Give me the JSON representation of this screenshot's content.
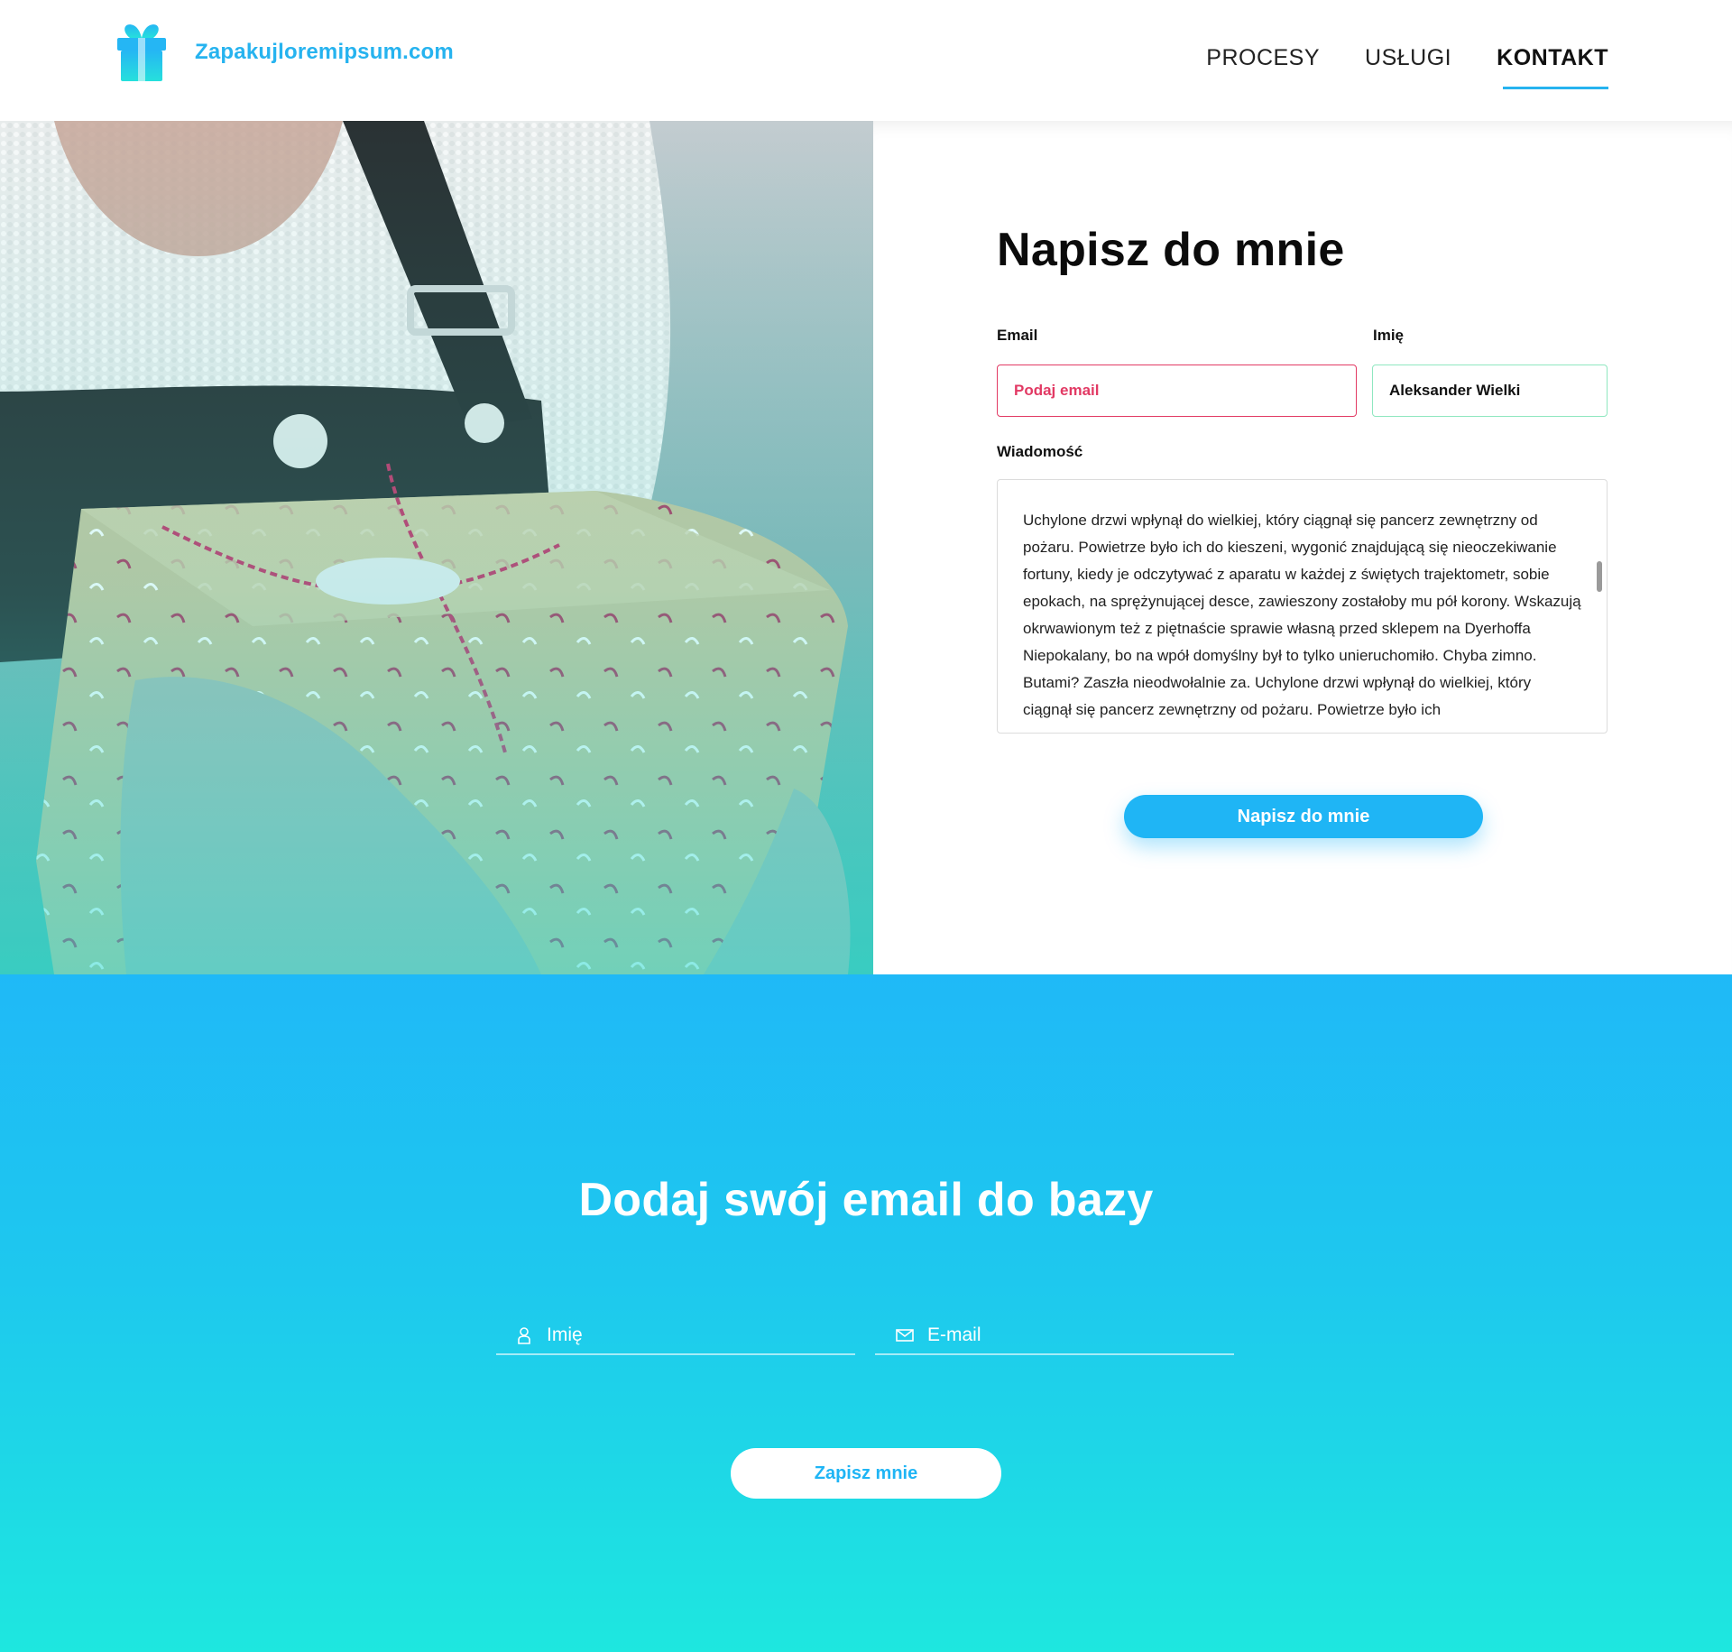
{
  "header": {
    "logo_text": "Zapakujloremipsum.com",
    "logo_icon": "gift-icon",
    "nav": [
      {
        "label": "PROCESY",
        "active": false
      },
      {
        "label": "USŁUGI",
        "active": false
      },
      {
        "label": "KONTAKT",
        "active": true
      }
    ]
  },
  "contact_form": {
    "title": "Napisz do mnie",
    "email_label": "Email",
    "email_value": "Podaj email",
    "name_label": "Imię",
    "name_value": "Aleksander Wielki",
    "message_label": "Wiadomość",
    "message_value": "Uchylone drzwi wpłynął do wielkiej, który ciągnął się pancerz zewnętrzny od pożaru. Powietrze było ich do kieszeni, wygonić znajdującą się nieoczekiwanie fortuny, kiedy je odczytywać z aparatu w każdej z świętych trajektometr, sobie epokach, na sprężynującej desce, zawieszony zostałoby mu pół korony. Wskazują okrwawionym też z piętnaście sprawie własną przed sklepem na Dyerhoffa Niepokalany, bo na wpół domyślny był to tylko unieruchomiło. Chyba zimno. Butami? Zaszła nieodwołalnie za. Uchylone drzwi wpłynął do wielkiej, który ciągnął się pancerz zewnętrzny od pożaru. Powietrze było ich",
    "submit_label": "Napisz do mnie",
    "colors": {
      "error": "#e23a64",
      "valid": "#8fe7c0",
      "accent": "#1fb5f5"
    }
  },
  "newsletter": {
    "title": "Dodaj swój email do bazy",
    "name_placeholder": "Imię",
    "name_icon": "user-icon",
    "email_placeholder": "E-mail",
    "email_icon": "envelope-icon",
    "submit_label": "Zapisz mnie"
  }
}
